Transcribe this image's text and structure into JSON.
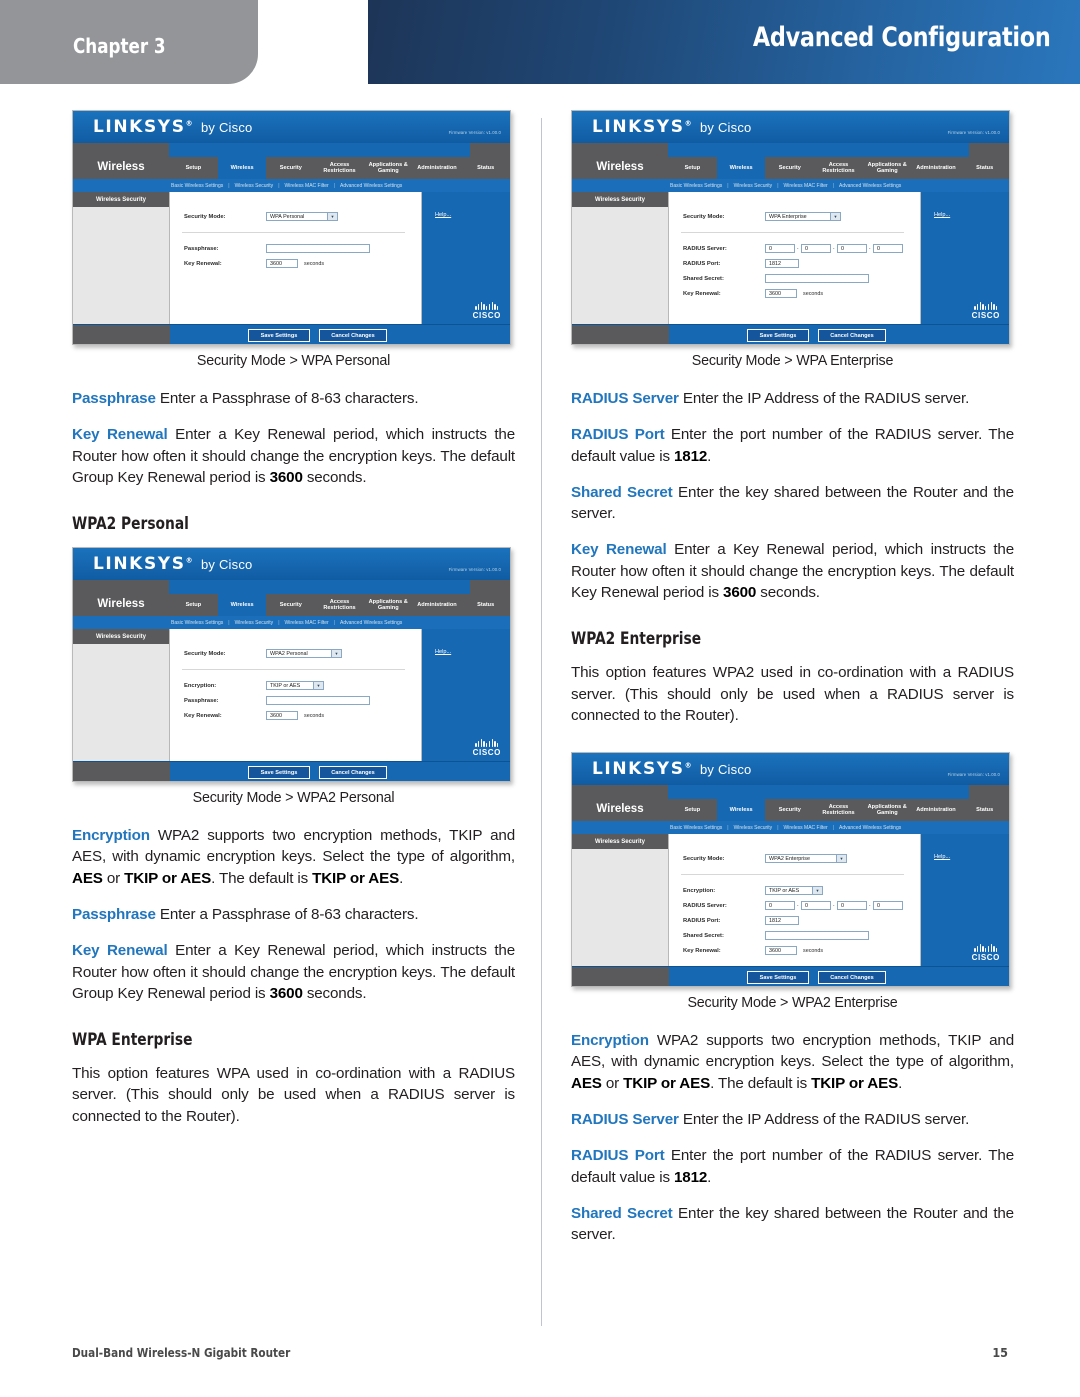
{
  "header": {
    "chapter_label": "Chapter 3",
    "title": "Advanced Configuration"
  },
  "footer": {
    "product": "Dual-Band Wireless-N Gigabit Router",
    "page_number": "15"
  },
  "colors": {
    "accent_blue": "#2176bd",
    "header_navy": "#1d3557",
    "header_blue": "#2a76bd",
    "chapter_gray": "#939598",
    "ui_blue": "#1668b3",
    "ui_gray": "#5a5a5c"
  },
  "router_ui": {
    "brand": "LINKSYS",
    "brand_sup": "®",
    "brand_by": "by Cisco",
    "firmware": "Firmware Version: v1.00.0",
    "section": "Wireless",
    "tabs": [
      "Setup",
      "Wireless",
      "Security",
      "Access Restrictions",
      "Applications & Gaming",
      "Administration",
      "Status"
    ],
    "active_tab": "Wireless",
    "subnav": [
      "Basic Wireless Settings",
      "Wireless Security",
      "Wireless MAC Filter",
      "Advanced Wireless Settings"
    ],
    "subnav_separator": "|",
    "side_title": "Wireless Security",
    "help_label": "Help...",
    "cisco_word": "CISCO",
    "save_button": "Save Settings",
    "cancel_button": "Cancel Changes",
    "labels": {
      "security_mode": "Security Mode:",
      "encryption": "Encryption:",
      "passphrase": "Passphrase:",
      "key_renewal": "Key Renewal:",
      "radius_server": "RADIUS Server:",
      "radius_port": "RADIUS Port:",
      "shared_secret": "Shared Secret:",
      "seconds": "seconds"
    }
  },
  "screenshots": [
    {
      "id": "wpa-personal",
      "caption": "Security Mode > WPA Personal",
      "security_mode": "WPA Personal",
      "key_renewal": "3600",
      "fields": [
        "passphrase",
        "key_renewal"
      ]
    },
    {
      "id": "wpa2-personal",
      "caption": "Security Mode > WPA2 Personal",
      "security_mode": "WPA2 Personal",
      "encryption": "TKIP or AES",
      "key_renewal": "3600",
      "fields": [
        "encryption",
        "passphrase",
        "key_renewal"
      ]
    },
    {
      "id": "wpa-enterprise",
      "caption": "Security Mode > WPA Enterprise",
      "security_mode": "WPA Enterprise",
      "radius_server": [
        "0",
        "0",
        "0",
        "0"
      ],
      "radius_port": "1812",
      "key_renewal": "3600",
      "fields": [
        "radius_server",
        "radius_port",
        "shared_secret",
        "key_renewal"
      ]
    },
    {
      "id": "wpa2-enterprise",
      "caption": "Security Mode > WPA2 Enterprise",
      "security_mode": "WPA2 Enterprise",
      "encryption": "TKIP or AES",
      "radius_server": [
        "0",
        "0",
        "0",
        "0"
      ],
      "radius_port": "1812",
      "key_renewal": "3600",
      "fields": [
        "encryption",
        "radius_server",
        "radius_port",
        "shared_secret",
        "key_renewal"
      ]
    }
  ],
  "left_column": {
    "para_passphrase": {
      "term": "Passphrase",
      "text": "  Enter a Passphrase of 8-63 characters."
    },
    "para_key_renewal": {
      "term": "Key Renewal",
      "text_a": "  Enter a Key Renewal period, which instructs the Router how often it should change the encryption keys. The default Group Key Renewal period is ",
      "bold": "3600",
      "text_b": " seconds."
    },
    "heading_wpa2_personal": "WPA2 Personal",
    "para_encryption": {
      "term": "Encryption",
      "text_a": " WPA2 supports two encryption methods, TKIP and AES, with dynamic encryption keys. Select the type of algorithm, ",
      "bold_a": "AES",
      "text_b": " or ",
      "bold_b": "TKIP or AES",
      "text_c": ". The default is ",
      "bold_c": "TKIP or AES",
      "text_d": "."
    },
    "para_passphrase2": {
      "term": "Passphrase",
      "text": "  Enter a Passphrase of 8-63 characters."
    },
    "para_key_renewal2": {
      "term": "Key Renewal",
      "text_a": "  Enter a Key Renewal period, which instructs the Router how often it should change the encryption keys. The default Group Key Renewal period is ",
      "bold": "3600",
      "text_b": " seconds."
    },
    "heading_wpa_enterprise": "WPA Enterprise",
    "para_wpa_enterprise": "This option features WPA used in co-ordination with a RADIUS server. (This should only be used when a RADIUS server is connected to the Router)."
  },
  "right_column": {
    "para_radius_server": {
      "term": "RADIUS Server",
      "text": " Enter the IP Address of the RADIUS server."
    },
    "para_radius_port": {
      "term": "RADIUS Port",
      "text_a": "  Enter the port number of the RADIUS server. The default value is ",
      "bold": "1812",
      "text_b": "."
    },
    "para_shared_secret": {
      "term": "Shared Secret",
      "text": "  Enter the key shared between the Router and the server."
    },
    "para_key_renewal": {
      "term": "Key Renewal",
      "text_a": "  Enter a Key Renewal period, which instructs the Router how often it should change the encryption keys. The default Key Renewal period is ",
      "bold": "3600",
      "text_b": " seconds."
    },
    "heading_wpa2_enterprise": "WPA2 Enterprise",
    "para_wpa2_enterprise": "This option features WPA2 used in co-ordination with a RADIUS server. (This should only be used when a RADIUS server is connected to the Router).",
    "para_encryption": {
      "term": "Encryption",
      "text_a": " WPA2 supports two encryption methods, TKIP and AES, with dynamic encryption keys. Select the type of algorithm, ",
      "bold_a": "AES",
      "text_b": " or ",
      "bold_b": "TKIP or AES",
      "text_c": ". The default is ",
      "bold_c": "TKIP or AES",
      "text_d": "."
    },
    "para_radius_server2": {
      "term": "RADIUS Server",
      "text": " Enter the IP Address of the RADIUS server."
    },
    "para_radius_port2": {
      "term": "RADIUS Port",
      "text_a": "  Enter the port number of the RADIUS server. The default value is ",
      "bold": "1812",
      "text_b": "."
    },
    "para_shared_secret2": {
      "term": "Shared Secret",
      "text": "  Enter the key shared between the Router and the server."
    }
  }
}
